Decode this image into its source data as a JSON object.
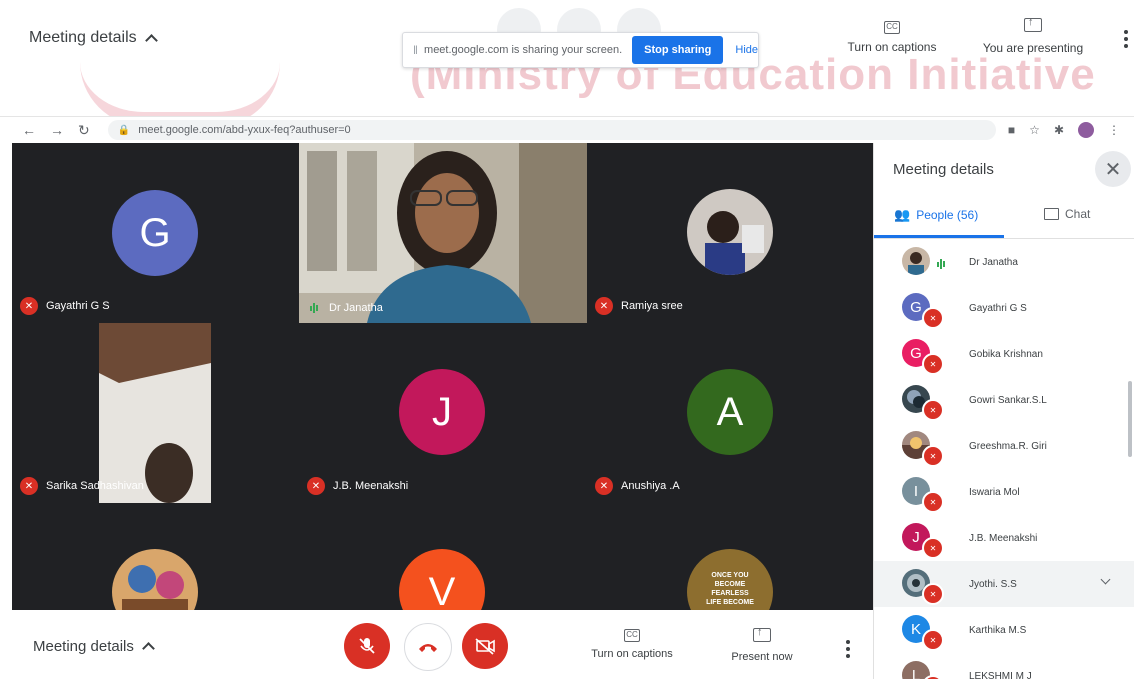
{
  "top_bar": {
    "meeting_details": "Meeting details",
    "watermark": "(Ministry of Education Initiative",
    "share_notice": "meet.google.com is sharing your screen.",
    "stop_sharing": "Stop sharing",
    "hide": "Hide",
    "captions": "Turn on captions",
    "presenting": "You are presenting"
  },
  "browser": {
    "url": "meet.google.com/abd-yxux-feq?authuser=0"
  },
  "tiles": [
    {
      "name": "Gayathri G S",
      "initial": "G",
      "color": "#5c6bc0",
      "mic": "muted"
    },
    {
      "name": "Dr Janatha",
      "initial": "",
      "color": "",
      "mic": "speaking"
    },
    {
      "name": "Ramiya sree",
      "initial": "",
      "color": "",
      "mic": "muted"
    },
    {
      "name": "Sarika Sadhashivan",
      "initial": "",
      "color": "",
      "mic": "muted"
    },
    {
      "name": "J.B. Meenakshi",
      "initial": "J",
      "color": "#c2185b",
      "mic": "muted"
    },
    {
      "name": "Anushiya .A",
      "initial": "A",
      "color": "#33691e",
      "mic": "muted"
    },
    {
      "name": "",
      "initial": "",
      "color": "",
      "mic": "none"
    },
    {
      "name": "",
      "initial": "V",
      "color": "#f4511e",
      "mic": "none"
    },
    {
      "name": "",
      "initial": "",
      "color": "",
      "mic": "none"
    }
  ],
  "tile_poster_text": "ONCE YOU BECOME FEARLESS LIFE BECOME",
  "bottom_bar": {
    "meeting_details": "Meeting details",
    "captions": "Turn on captions",
    "present_now": "Present now"
  },
  "panel": {
    "title": "Meeting details",
    "people_tab": "People (56)",
    "chat_tab": "Chat",
    "people": [
      {
        "name": "Dr Janatha",
        "initial": "",
        "color": "#c8b7a6",
        "status": "speaking"
      },
      {
        "name": "Gayathri G S",
        "initial": "G",
        "color": "#5c6bc0",
        "status": "muted"
      },
      {
        "name": "Gobika Krishnan",
        "initial": "G",
        "color": "#e91e63",
        "status": "muted"
      },
      {
        "name": "Gowri Sankar.S.L",
        "initial": "",
        "color": "#37474f",
        "status": "muted"
      },
      {
        "name": "Greeshma.R. Giri",
        "initial": "",
        "color": "#a1887f",
        "status": "muted"
      },
      {
        "name": "Iswaria Mol",
        "initial": "I",
        "color": "#78909c",
        "status": "muted"
      },
      {
        "name": "J.B. Meenakshi",
        "initial": "J",
        "color": "#c2185b",
        "status": "muted"
      },
      {
        "name": "Jyothi. S.S",
        "initial": "",
        "color": "#546e7a",
        "status": "muted"
      },
      {
        "name": "Karthika M.S",
        "initial": "K",
        "color": "#1e88e5",
        "status": "muted"
      },
      {
        "name": "LEKSHMI M J",
        "initial": "L",
        "color": "#8d6e63",
        "status": "muted"
      }
    ]
  },
  "colors": {
    "accent": "#1a73e8",
    "danger": "#d93025",
    "grid_bg": "#202124"
  }
}
